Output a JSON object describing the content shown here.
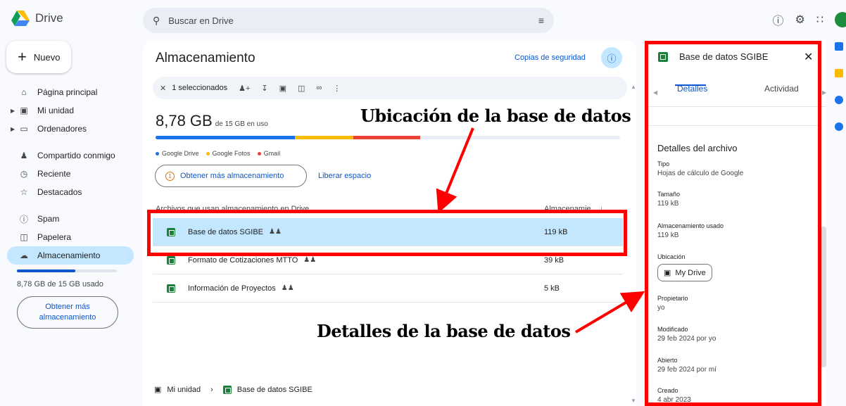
{
  "app": {
    "name": "Drive"
  },
  "search": {
    "placeholder": "Buscar en Drive"
  },
  "sidebar": {
    "new_label": "Nuevo",
    "items": [
      {
        "label": "Página principal",
        "icon": "home-icon"
      },
      {
        "label": "Mi unidad",
        "icon": "drive-icon"
      },
      {
        "label": "Ordenadores",
        "icon": "computer-icon"
      },
      {
        "label": "Compartido conmigo",
        "icon": "people-icon"
      },
      {
        "label": "Reciente",
        "icon": "clock-icon"
      },
      {
        "label": "Destacados",
        "icon": "star-icon"
      },
      {
        "label": "Spam",
        "icon": "spam-icon"
      },
      {
        "label": "Papelera",
        "icon": "trash-icon"
      },
      {
        "label": "Almacenamiento",
        "icon": "cloud-icon"
      }
    ],
    "quota_text": "8,78 GB de 15 GB usado",
    "quota_fraction": 0.585,
    "more_storage_label": "Obtener más almacenamiento"
  },
  "main": {
    "title": "Almacenamiento",
    "backup_link": "Copias de seguridad",
    "selection": {
      "count_label": "1 seleccionados"
    },
    "storage_used": "8,78 GB",
    "storage_total": "de 15 GB en uso",
    "usage_segments": [
      {
        "name": "Google Drive",
        "fraction": 0.3,
        "color": "#1a73e8"
      },
      {
        "name": "Google Fotos",
        "fraction": 0.125,
        "color": "#fbbc04"
      },
      {
        "name": "Gmail",
        "fraction": 0.145,
        "color": "#ea4335"
      }
    ],
    "get_more_label": "Obtener más almacenamiento",
    "free_space_label": "Liberar espacio",
    "columns": {
      "name": "Archivos que usan almacenamiento en Drive",
      "size": "Almacenamie..."
    },
    "files": [
      {
        "name": "Base de datos SGIBE",
        "size": "119 kB",
        "selected": true
      },
      {
        "name": "Formato de Cotizaciones MTTO",
        "size": "39 kB",
        "selected": false
      },
      {
        "name": "Información de Proyectos",
        "size": "5 kB",
        "selected": false
      }
    ],
    "breadcrumb": {
      "root": "Mi unidad",
      "current": "Base de datos SGIBE"
    }
  },
  "annotations": {
    "location_text": "Ubicación de la base de datos",
    "details_text": "Detalles de la base de datos",
    "color": "#ff0000"
  },
  "details_panel": {
    "file_name": "Base de datos SGIBE",
    "tabs": {
      "details": "Detalles",
      "activity": "Actividad"
    },
    "section_title": "Detalles del archivo",
    "type_label": "Tipo",
    "type_value": "Hojas de cálculo de Google",
    "size_label": "Tamaño",
    "size_value": "119 kB",
    "storage_label": "Almacenamiento usado",
    "storage_value": "119 kB",
    "location_label": "Ubicación",
    "location_value": "My Drive",
    "owner_label": "Propietario",
    "owner_value": "yo",
    "modified_label": "Modificado",
    "modified_value": "29 feb 2024 por yo",
    "opened_label": "Abierto",
    "opened_value": "29 feb 2024 por mí",
    "created_label": "Creado",
    "created_value": "4 abr 2023"
  }
}
